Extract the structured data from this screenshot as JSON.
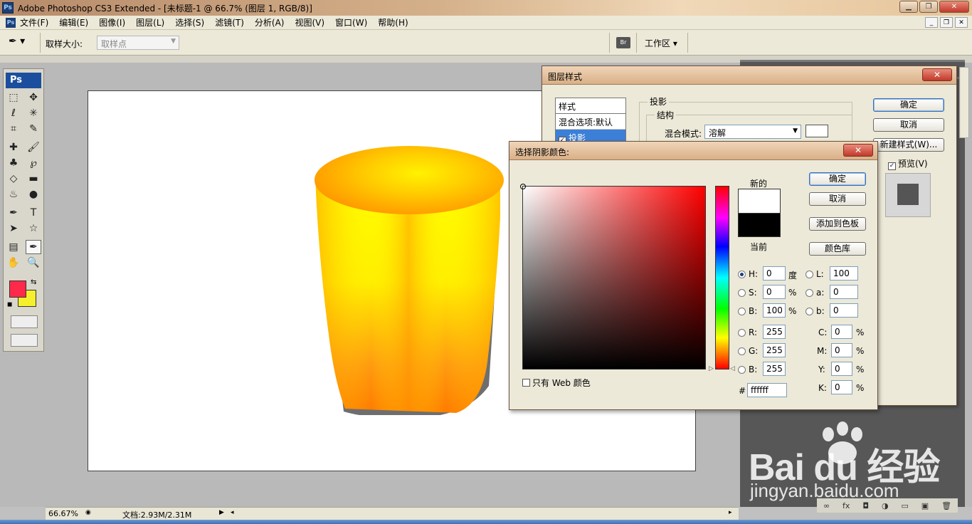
{
  "window": {
    "logo_text": "Ps",
    "title": "Adobe Photoshop CS3 Extended - [未标题-1 @ 66.7% (图层 1, RGB/8)]",
    "buttons": [
      "minimize-icon",
      "restore-icon",
      "close-icon"
    ]
  },
  "menu": {
    "logo_text": "Ps",
    "items": [
      "文件(F)",
      "编辑(E)",
      "图像(I)",
      "图层(L)",
      "选择(S)",
      "滤镜(T)",
      "分析(A)",
      "视图(V)",
      "窗口(W)",
      "帮助(H)"
    ]
  },
  "options": {
    "sample_size_label": "取样大小:",
    "sample_size_value": "取样点",
    "workspace_label": "工作区 ▾"
  },
  "toolbox": {
    "logo_text": "Ps",
    "foreground_color": "#ff2a4a",
    "background_color": "#f6f02c"
  },
  "status": {
    "zoom": "66.67%",
    "doc_info": "文档:2.93M/2.31M"
  },
  "layer_style_dialog": {
    "title": "图层样式",
    "styles_header": "样式",
    "blend_options": "混合选项:默认",
    "drop_shadow_item": "投影",
    "section_title": "投影",
    "structure_title": "结构",
    "blend_mode_label": "混合模式:",
    "blend_mode_value": "溶解",
    "ok": "确定",
    "cancel": "取消",
    "new_style": "新建样式(W)...",
    "preview": "预览(V)"
  },
  "color_picker": {
    "title": "选择阴影颜色:",
    "new_label": "新的",
    "current_label": "当前",
    "new_color": "#ffffff",
    "current_color": "#000000",
    "ok": "确定",
    "cancel": "取消",
    "add_to_swatches": "添加到色板",
    "color_libraries": "颜色库",
    "web_only": "只有 Web 颜色",
    "hsb": {
      "h_label": "H:",
      "h_value": "0",
      "h_unit": "度",
      "s_label": "S:",
      "s_value": "0",
      "s_unit": "%",
      "b_label": "B:",
      "b_value": "100",
      "b_unit": "%"
    },
    "rgb": {
      "r_label": "R:",
      "r_value": "255",
      "g_label": "G:",
      "g_value": "255",
      "b_label": "B:",
      "b_value": "255"
    },
    "lab": {
      "l_label": "L:",
      "l_value": "100",
      "a_label": "a:",
      "a_value": "0",
      "b_label": "b:",
      "b_value": "0"
    },
    "cmyk": {
      "c_label": "C:",
      "c_value": "0",
      "m_label": "M:",
      "m_value": "0",
      "y_label": "Y:",
      "y_value": "0",
      "k_label": "K:",
      "k_value": "0",
      "unit": "%"
    },
    "hex_label": "#",
    "hex_value": "ffffff"
  },
  "watermark": {
    "main": "Bai du 经验",
    "sub": "jingyan.baidu.com"
  }
}
